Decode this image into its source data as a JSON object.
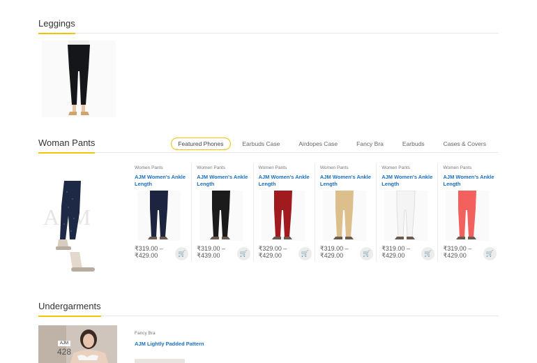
{
  "sections": {
    "leggings": {
      "title": "Leggings"
    },
    "woman_pants": {
      "title": "Woman Pants",
      "tabs": [
        "Featured Phones",
        "Earbuds Case",
        "Airdopes Case",
        "Fancy Bra",
        "Earbuds",
        "Cases & Covers"
      ],
      "active_tab": "Featured Phones",
      "feature_watermark": "AJM",
      "products": [
        {
          "category": "Women Pants",
          "name": "AJM Women's Ankle Length",
          "price": "₹319.00 – ₹429.00",
          "color": "#1c2440"
        },
        {
          "category": "Women Pants",
          "name": "AJM Women's Ankle Length",
          "price": "₹319.00 – ₹439.00",
          "color": "#1b1b1b"
        },
        {
          "category": "Women Pants",
          "name": "AJM Women's Ankle Length",
          "price": "₹329.00 – ₹429.00",
          "color": "#a11a1f"
        },
        {
          "category": "Women Pants",
          "name": "AJM Women's Ankle Length",
          "price": "₹319.00 – ₹429.00",
          "color": "#dcbf8a"
        },
        {
          "category": "Women Pants",
          "name": "AJM Women's Ankle Length",
          "price": "₹319.00 – ₹429.00",
          "color": "#f4f4f4"
        },
        {
          "category": "Women Pants",
          "name": "AJM Women's Ankle Length",
          "price": "₹319.00 – ₹429.00",
          "color": "#f2615e"
        }
      ]
    },
    "undergarments": {
      "title": "Undergarments",
      "image_tag": "AJM",
      "image_number": "428",
      "product": {
        "category": "Fancy Bra",
        "name": "AJM Lightly Padded Pattern"
      }
    }
  },
  "colors": {
    "accent": "#f5c400",
    "link": "#1a6fc0"
  },
  "icons": {
    "cart": "cart-icon"
  }
}
